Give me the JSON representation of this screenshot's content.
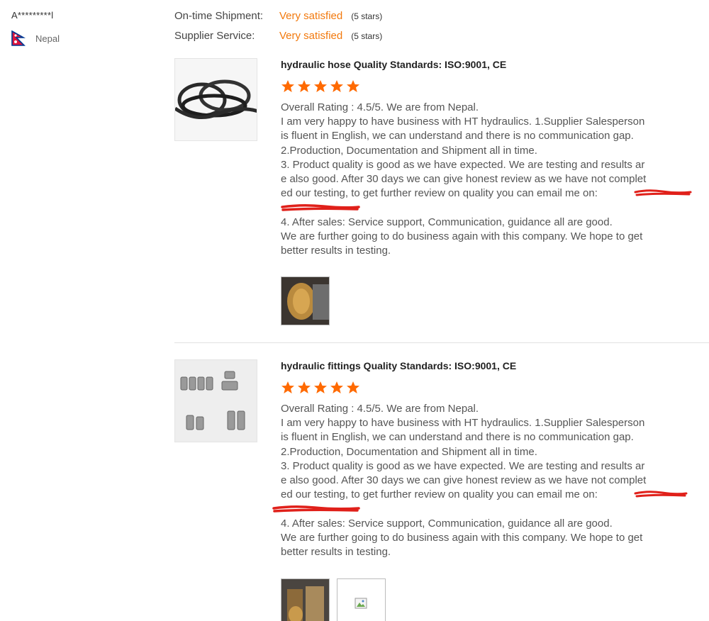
{
  "reviewer": {
    "name": "A*********l",
    "country": "Nepal"
  },
  "satisfaction": [
    {
      "label": "On-time Shipment:",
      "value": "Very satisfied",
      "stars": "(5 stars)"
    },
    {
      "label": "Supplier Service:",
      "value": "Very satisfied",
      "stars": "(5 stars)"
    }
  ],
  "reviews": [
    {
      "title": "hydraulic hose Quality Standards: ISO:9001, CE",
      "rating_stars": 5,
      "lines": [
        "Overall Rating : 4.5/5. We are from Nepal.",
        "I am very happy to have business with HT hydraulics. 1.Supplier Salesperson",
        "is fluent in English, we can understand and there is no communication gap.",
        "2.Production, Documentation and Shipment all in time.",
        "3. Product quality is good as we have expected. We are testing and results ar",
        "e also good. After 30 days we can give honest review as we have not complet",
        "ed our testing, to get further review on quality you can email me on:",
        "4. After sales: Service support, Communication, guidance all are good.",
        "We are further going to do business again with this company. We hope to get",
        "better results in testing."
      ]
    },
    {
      "title": "hydraulic fittings Quality Standards: ISO:9001, CE",
      "rating_stars": 5,
      "lines": [
        "Overall Rating : 4.5/5. We are from Nepal.",
        "I am very happy to have business with HT hydraulics. 1.Supplier Salesperson",
        "is fluent in English, we can understand and there is no communication gap.",
        "2.Production, Documentation and Shipment all in time.",
        "3. Product quality is good as we have expected. We are testing and results ar",
        "e also good. After 30 days we can give honest review as we have not complet",
        "ed our testing, to get further review on quality you can email me on:",
        "4. After sales: Service support, Communication, guidance all are good.",
        "We are further going to do business again with this company. We hope to get",
        "better results in testing."
      ]
    }
  ],
  "colors": {
    "accent": "#f2790d",
    "star": "#ff6a00",
    "redaction": "#e0201a"
  }
}
